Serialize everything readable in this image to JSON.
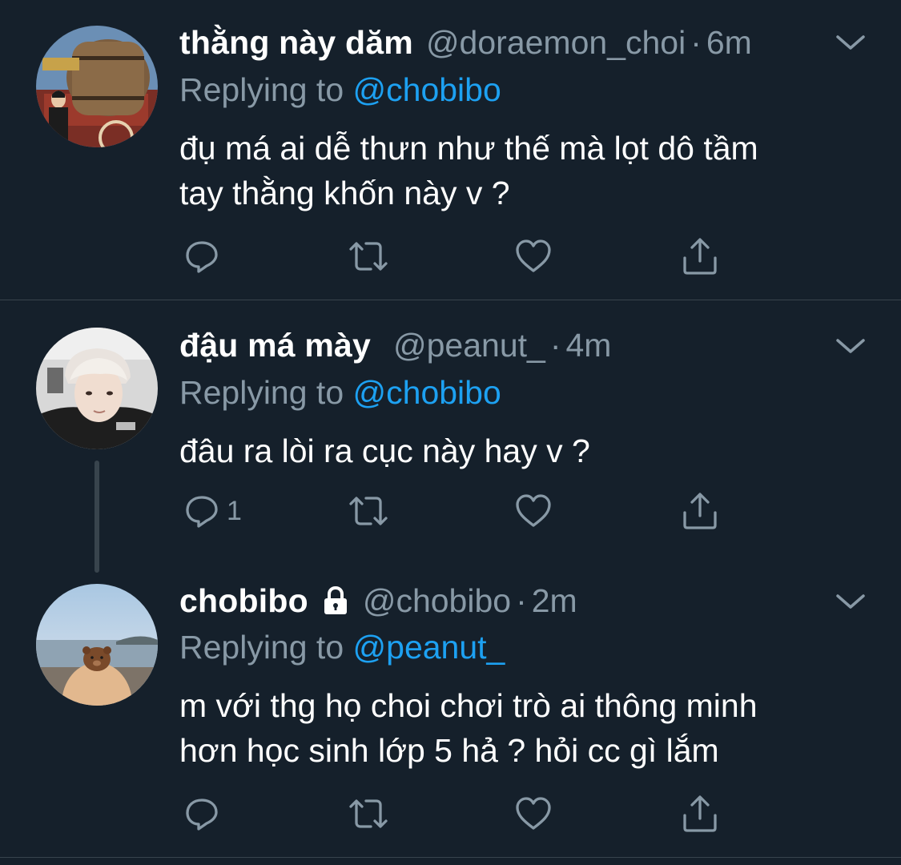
{
  "tweets": [
    {
      "display_name": "thằng này dăm",
      "handle": "@doraemon_choi",
      "separator": "·",
      "time": "6m",
      "replying_prefix": "Replying to",
      "replying_to": "@chobibo",
      "lines": [
        "đụ má ai dễ thưn như thế mà lọt dô tầm",
        "tay thằng khốn này v ?"
      ],
      "reply_count": "",
      "icons": [
        "reply-icon",
        "retweet-icon",
        "like-icon",
        "share-icon"
      ]
    },
    {
      "display_name": "đậu má mày",
      "handle": "@peanut_",
      "separator": "·",
      "time": "4m",
      "replying_prefix": "Replying to",
      "replying_to": "@chobibo",
      "lines": [
        "đâu ra lòi ra cục này hay v ?"
      ],
      "reply_count": "1",
      "icons": [
        "reply-icon",
        "retweet-icon",
        "like-icon",
        "share-icon"
      ]
    },
    {
      "display_name": "chobibo",
      "protected": true,
      "handle": "@chobibo",
      "separator": "·",
      "time": "2m",
      "replying_prefix": "Replying to",
      "replying_to": "@peanut_",
      "lines": [
        "m với thg họ choi chơi trò ai thông minh",
        "hơn học sinh lớp 5 hả ? hỏi cc gì lắm"
      ],
      "reply_count": "",
      "icons": [
        "reply-icon",
        "retweet-icon",
        "like-icon",
        "share-icon",
        "lock-icon",
        "chevron-down-icon"
      ]
    }
  ],
  "colors": {
    "background": "#15202b",
    "text": "#ffffff",
    "secondary": "#8899a6",
    "mention": "#1da1f2",
    "divider": "#38444d"
  }
}
